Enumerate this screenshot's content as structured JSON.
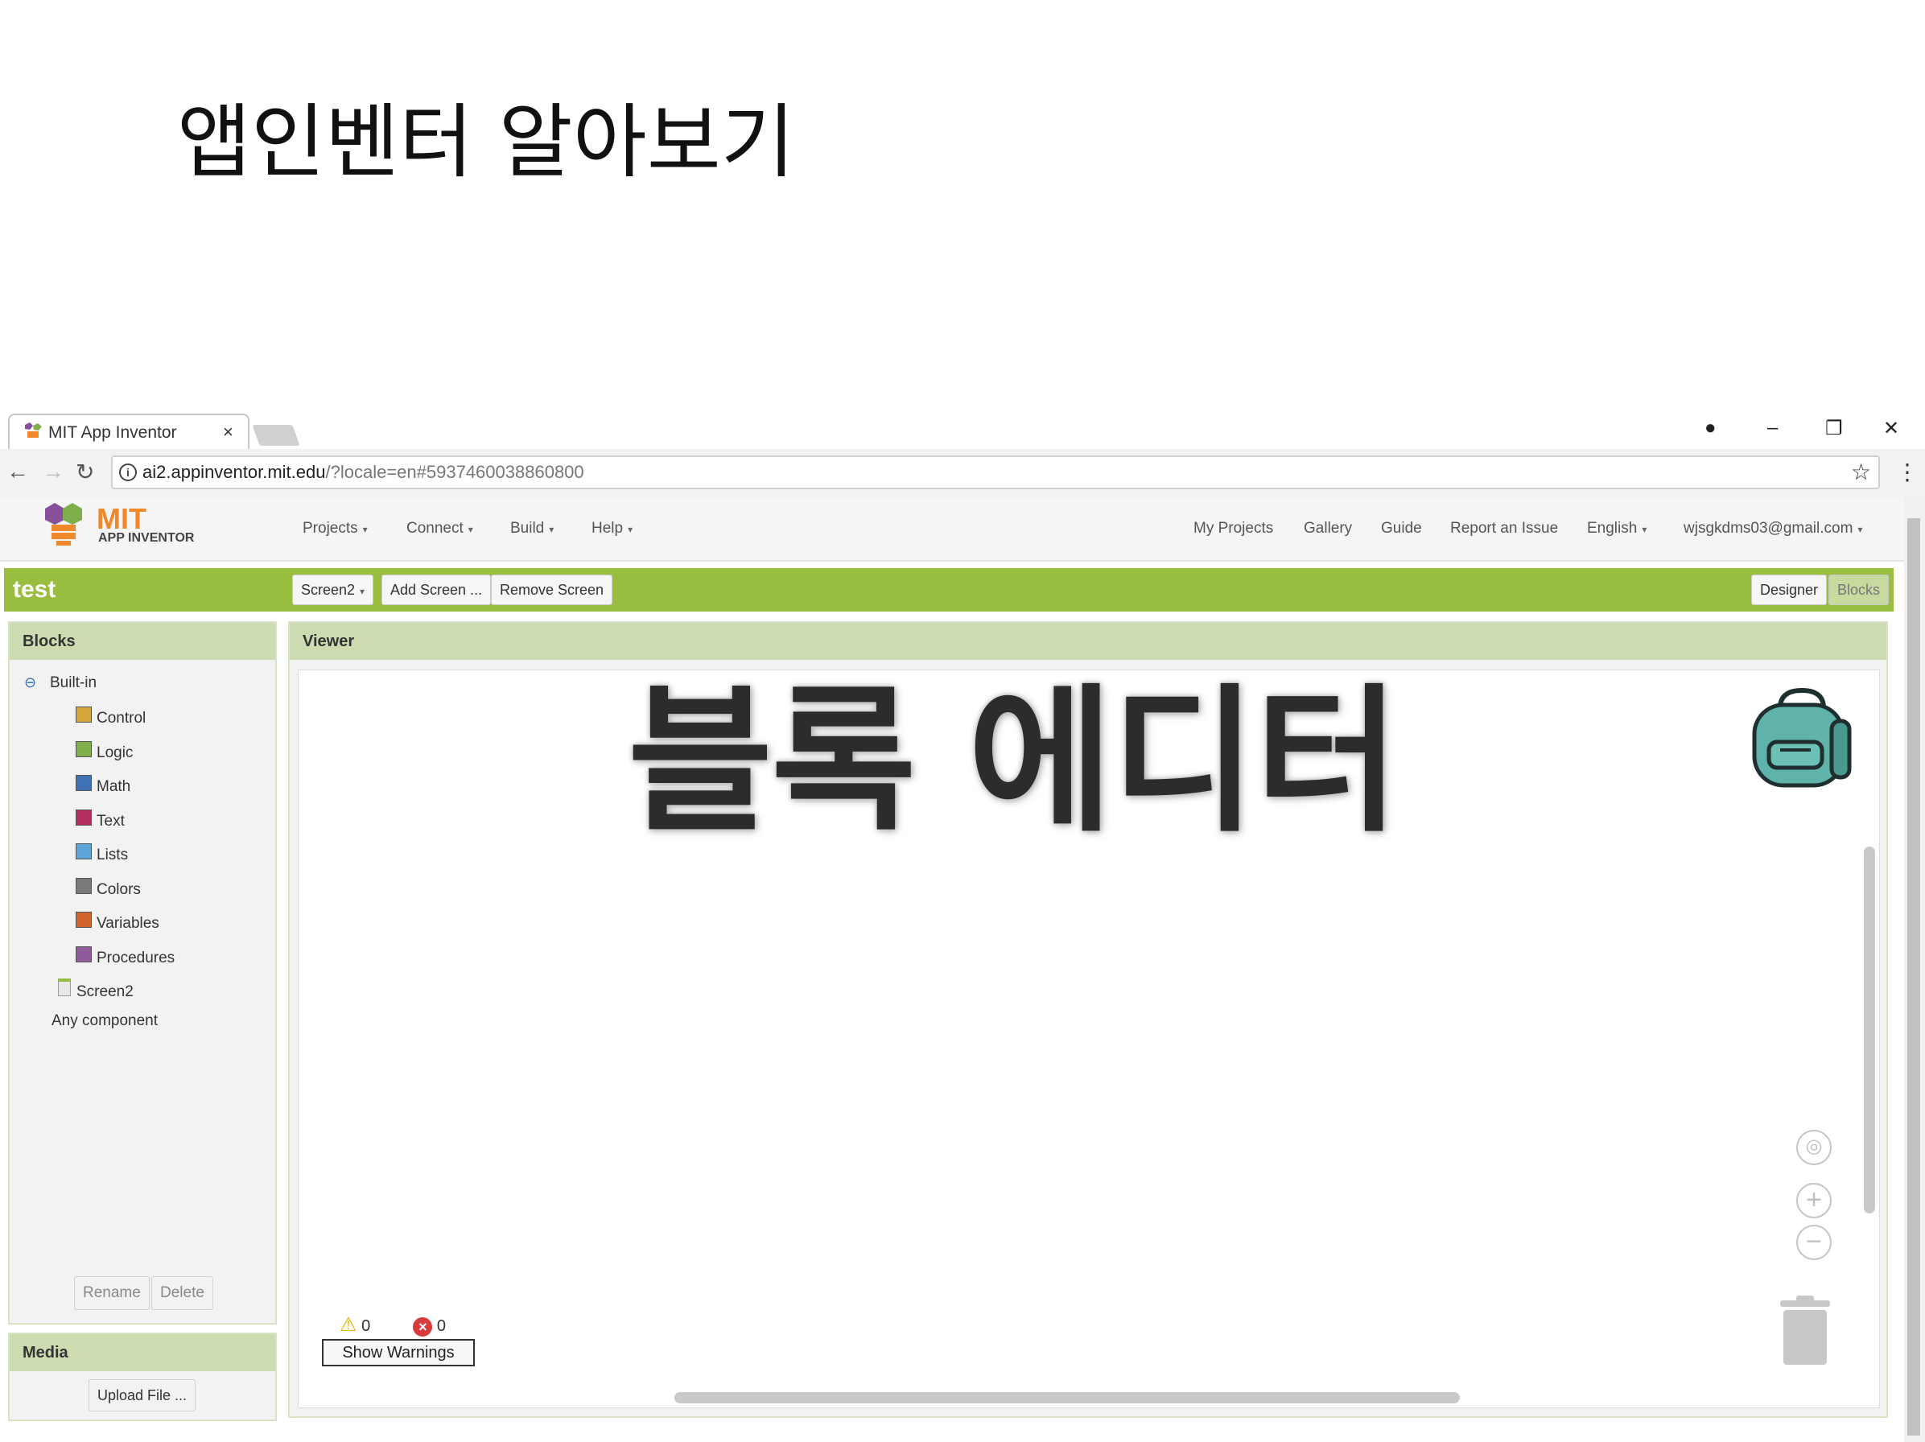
{
  "slide": {
    "title": "앱인벤터 알아보기"
  },
  "browser": {
    "tab_title": "MIT App Inventor",
    "tab_close": "×",
    "url_host": "ai2.appinventor.mit.edu",
    "url_rest": "/?locale=en#5937460038860800",
    "window_controls": {
      "minimize": "–",
      "restore": "❐",
      "close": "✕",
      "profile": "●"
    }
  },
  "app": {
    "logo_text": "MIT",
    "logo_subtext": "APP INVENTOR",
    "menu": [
      {
        "label": "Projects"
      },
      {
        "label": "Connect"
      },
      {
        "label": "Build"
      },
      {
        "label": "Help"
      }
    ],
    "right_menu": {
      "my_projects": "My Projects",
      "gallery": "Gallery",
      "guide": "Guide",
      "report": "Report an Issue",
      "language": "English",
      "account": "wjsgkdms03@gmail.com"
    },
    "caret": "▾"
  },
  "project": {
    "name": "test",
    "screen_select": "Screen2",
    "add_screen": "Add Screen ...",
    "remove_screen": "Remove Screen",
    "designer": "Designer",
    "blocks": "Blocks"
  },
  "blocks_panel": {
    "title": "Blocks",
    "built_in": "Built-in",
    "collapse_symbol": "⊖",
    "items": [
      {
        "label": "Control",
        "color": "#d6a63f"
      },
      {
        "label": "Logic",
        "color": "#7fae4a"
      },
      {
        "label": "Math",
        "color": "#3f71b5"
      },
      {
        "label": "Text",
        "color": "#b32d5e"
      },
      {
        "label": "Lists",
        "color": "#5ba5d8"
      },
      {
        "label": "Colors",
        "color": "#7a7a7a"
      },
      {
        "label": "Variables",
        "color": "#d0652c"
      },
      {
        "label": "Procedures",
        "color": "#8f5b99"
      }
    ],
    "screen": "Screen2",
    "any_component": "Any component",
    "rename": "Rename",
    "delete": "Delete"
  },
  "media_panel": {
    "title": "Media",
    "upload": "Upload File ..."
  },
  "viewer": {
    "title": "Viewer",
    "overlay": "블록 에디터",
    "warnings_count": "0",
    "errors_count": "0",
    "show_warnings": "Show Warnings"
  }
}
